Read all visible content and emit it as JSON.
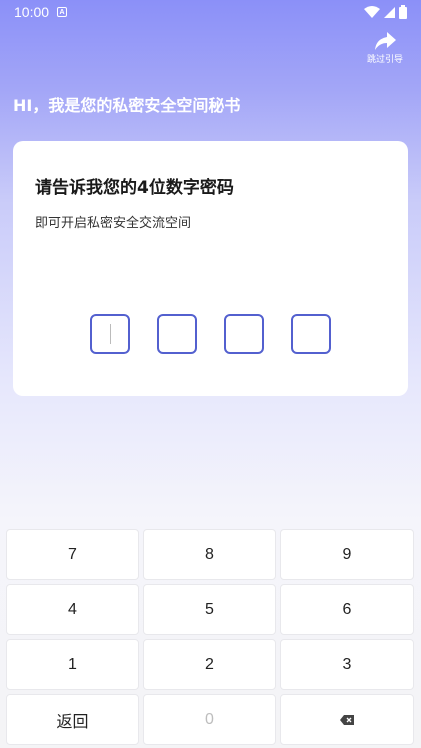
{
  "status_bar": {
    "time": "10:00",
    "notification_icon": "A"
  },
  "skip": {
    "label": "跳过引导",
    "icon": "share-arrow-icon"
  },
  "greeting": "HI，我是您的私密安全空间秘书",
  "card": {
    "title": "请告诉我您的4位数字密码",
    "subtitle": "即可开启私密安全交流空间",
    "pin_length": 4,
    "accent": "#5360cf"
  },
  "keypad": {
    "keys": [
      "7",
      "8",
      "9",
      "4",
      "5",
      "6",
      "1",
      "2",
      "3"
    ],
    "back_label": "返回",
    "zero_label": "0",
    "delete_icon": "backspace-icon"
  },
  "colors": {
    "gradient_top": "#8b90f8",
    "background": "#f4f4f6"
  }
}
